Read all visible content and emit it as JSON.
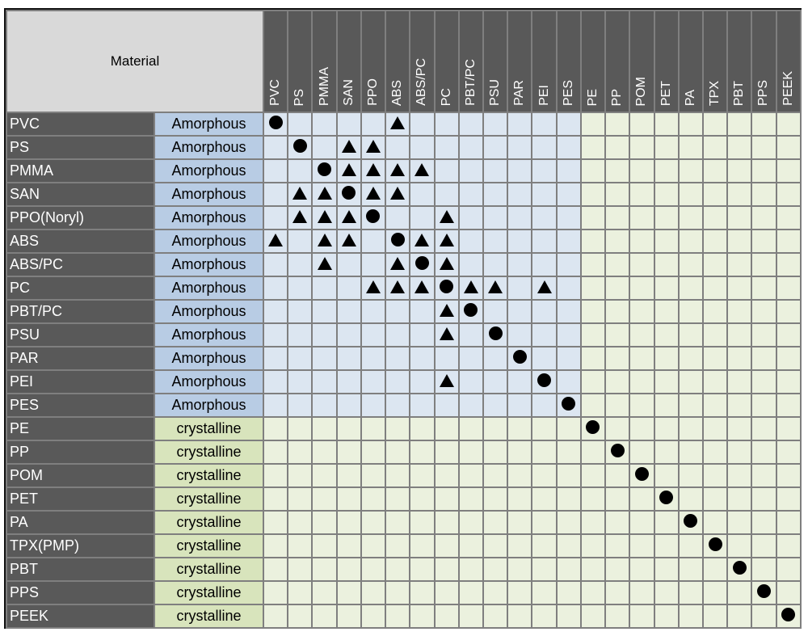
{
  "header": {
    "material_label": "Material"
  },
  "columns": [
    "PVC",
    "PS",
    "PMMA",
    "SAN",
    "PPO",
    "ABS",
    "ABS/PC",
    "PC",
    "PBT/PC",
    "PSU",
    "PAR",
    "PEI",
    "PES",
    "PE",
    "PP",
    "POM",
    "PET",
    "PA",
    "TPX",
    "PBT",
    "PPS",
    "PEEK"
  ],
  "legend_symbols": {
    "o": "circle",
    "t": "triangle"
  },
  "colors": {
    "header_dark": "#595959",
    "corner": "#d9d9d9",
    "amorphous_type": "#b8cce4",
    "crystalline_type": "#d8e4bc",
    "amorphous_cell": "#dce6f1",
    "crystalline_cell": "#ebf1de",
    "grid": "#7f7f7f"
  },
  "rows": [
    {
      "name": "PVC",
      "type": "Amorphous",
      "marks": {
        "0": "o",
        "5": "t"
      }
    },
    {
      "name": "PS",
      "type": "Amorphous",
      "marks": {
        "1": "o",
        "3": "t",
        "4": "t"
      }
    },
    {
      "name": "PMMA",
      "type": "Amorphous",
      "marks": {
        "2": "o",
        "3": "t",
        "4": "t",
        "5": "t",
        "6": "t"
      }
    },
    {
      "name": "SAN",
      "type": "Amorphous",
      "marks": {
        "1": "t",
        "2": "t",
        "3": "o",
        "4": "t",
        "5": "t"
      }
    },
    {
      "name": "PPO(Noryl)",
      "type": "Amorphous",
      "marks": {
        "1": "t",
        "2": "t",
        "3": "t",
        "4": "o",
        "7": "t"
      }
    },
    {
      "name": "ABS",
      "type": "Amorphous",
      "marks": {
        "0": "t",
        "2": "t",
        "3": "t",
        "5": "o",
        "6": "t",
        "7": "t"
      }
    },
    {
      "name": "ABS/PC",
      "type": "Amorphous",
      "marks": {
        "2": "t",
        "5": "t",
        "6": "o",
        "7": "t"
      }
    },
    {
      "name": "PC",
      "type": "Amorphous",
      "marks": {
        "4": "t",
        "5": "t",
        "6": "t",
        "7": "o",
        "8": "t",
        "9": "t",
        "11": "t"
      }
    },
    {
      "name": "PBT/PC",
      "type": "Amorphous",
      "marks": {
        "7": "t",
        "8": "o"
      }
    },
    {
      "name": "PSU",
      "type": "Amorphous",
      "marks": {
        "7": "t",
        "9": "o"
      }
    },
    {
      "name": "PAR",
      "type": "Amorphous",
      "marks": {
        "10": "o"
      }
    },
    {
      "name": "PEI",
      "type": "Amorphous",
      "marks": {
        "7": "t",
        "11": "o"
      }
    },
    {
      "name": "PES",
      "type": "Amorphous",
      "marks": {
        "12": "o"
      }
    },
    {
      "name": "PE",
      "type": "crystalline",
      "marks": {
        "13": "o"
      }
    },
    {
      "name": "PP",
      "type": "crystalline",
      "marks": {
        "14": "o"
      }
    },
    {
      "name": "POM",
      "type": "crystalline",
      "marks": {
        "15": "o"
      }
    },
    {
      "name": "PET",
      "type": "crystalline",
      "marks": {
        "16": "o"
      }
    },
    {
      "name": "PA",
      "type": "crystalline",
      "marks": {
        "17": "o"
      }
    },
    {
      "name": "TPX(PMP)",
      "type": "crystalline",
      "marks": {
        "18": "o"
      }
    },
    {
      "name": "PBT",
      "type": "crystalline",
      "marks": {
        "19": "o"
      }
    },
    {
      "name": "PPS",
      "type": "crystalline",
      "marks": {
        "20": "o"
      }
    },
    {
      "name": "PEEK",
      "type": "crystalline",
      "marks": {
        "21": "o"
      }
    }
  ]
}
